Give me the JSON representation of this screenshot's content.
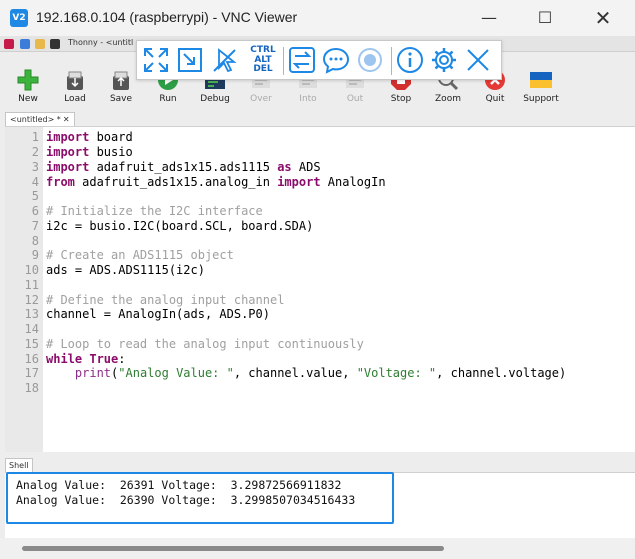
{
  "window": {
    "title": "192.168.0.104 (raspberrypi) - VNC Viewer",
    "logo_text": "V2",
    "minimize": "—",
    "maximize": "☐",
    "close": "✕"
  },
  "rpi_taskbar": {
    "thonny_task": "Thonny  -  <untitl"
  },
  "vnc_toolbar": {
    "ctrl": "CTRL",
    "alt": "ALT",
    "del": "DEL",
    "accent_color": "#1e88e5"
  },
  "thonny_toolbar": [
    {
      "label": "New",
      "icon": "new-icon"
    },
    {
      "label": "Load",
      "icon": "load-icon"
    },
    {
      "label": "Save",
      "icon": "save-icon"
    },
    {
      "label": "Run",
      "icon": "run-icon"
    },
    {
      "label": "Debug",
      "icon": "debug-icon"
    },
    {
      "label": "Over",
      "icon": "step-over-icon",
      "disabled": true
    },
    {
      "label": "Into",
      "icon": "step-into-icon",
      "disabled": true
    },
    {
      "label": "Out",
      "icon": "step-out-icon",
      "disabled": true
    },
    {
      "label": "Stop",
      "icon": "stop-icon"
    },
    {
      "label": "Zoom",
      "icon": "zoom-icon"
    },
    {
      "label": "Quit",
      "icon": "quit-icon"
    },
    {
      "label": "Support",
      "icon": "ukraine-flag-icon"
    }
  ],
  "editor": {
    "tab_label": "<untitled> *",
    "tab_close": "✕",
    "line_numbers": [
      "1",
      "2",
      "3",
      "4",
      "5",
      "6",
      "7",
      "8",
      "9",
      "10",
      "11",
      "12",
      "13",
      "14",
      "15",
      "16",
      "17",
      "18"
    ],
    "lines": {
      "l1_kw": "import",
      "l1_rest": " board",
      "l2_kw": "import",
      "l2_rest": " busio",
      "l3_kw": "import",
      "l3_mid": " adafruit_ads1x15.ads1115 ",
      "l3_kw2": "as",
      "l3_rest": " ADS",
      "l4_kw": "from",
      "l4_mid": " adafruit_ads1x15.analog_in ",
      "l4_kw2": "import",
      "l4_rest": " AnalogIn",
      "l6_cm": "# Initialize the I2C interface",
      "l7": "i2c = busio.I2C(board.SCL, board.SDA)",
      "l9_cm": "# Create an ADS1115 object",
      "l10": "ads = ADS.ADS1115(i2c)",
      "l12_cm": "# Define the analog input channel",
      "l13": "channel = AnalogIn(ads, ADS.P0)",
      "l15_cm": "# Loop to read the analog input continuously",
      "l16_kw": "while",
      "l16_kw2": " True",
      "l16_rest": ":",
      "l17_indent": "    ",
      "l17_bi": "print",
      "l17_a": "(",
      "l17_s1": "\"Analog Value: \"",
      "l17_b": ", channel.value, ",
      "l17_s2": "\"Voltage: \"",
      "l17_c": ", channel.voltage)"
    }
  },
  "shell": {
    "tab_label": "Shell",
    "output": [
      "Analog Value:  26391 Voltage:  3.29872566911832",
      "Analog Value:  26390 Voltage:  3.2998507034516433"
    ]
  }
}
